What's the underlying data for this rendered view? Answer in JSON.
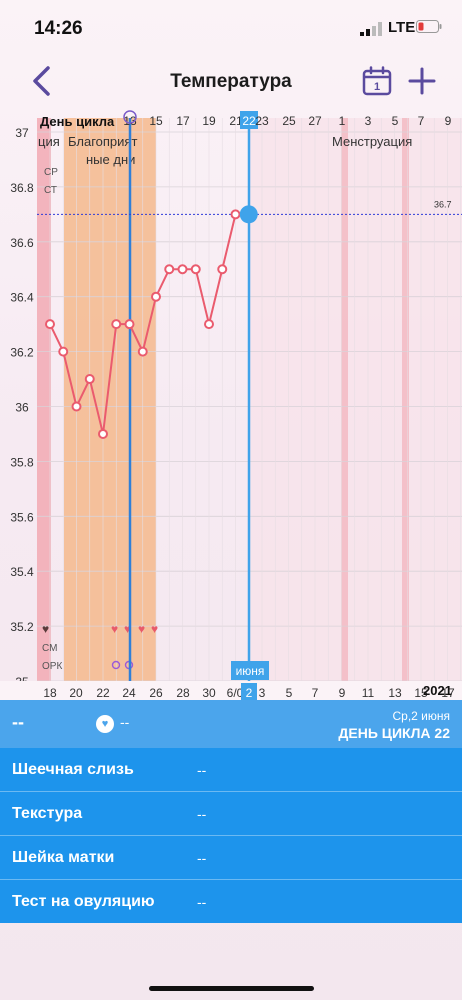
{
  "status": {
    "time": "14:26",
    "network": "LTE"
  },
  "header": {
    "title": "Температура",
    "calendar_day": "1"
  },
  "chart_data": {
    "type": "line",
    "top_axis_label": "День цикла",
    "cycle_days": [
      "13",
      "15",
      "17",
      "19",
      "21",
      "22",
      "23",
      "25",
      "27",
      "1",
      "3",
      "5",
      "7",
      "9"
    ],
    "selected_cycle_day": "22",
    "dates": [
      "18",
      "20",
      "22",
      "24",
      "26",
      "28",
      "30",
      "6/0",
      "2",
      "3",
      "5",
      "7",
      "9",
      "11",
      "13",
      "15",
      "17"
    ],
    "month_label": "июня",
    "year_label": "2021",
    "ylim": [
      35,
      37
    ],
    "y_ticks": [
      "37",
      "36.8",
      "36.6",
      "36.4",
      "36.2",
      "36",
      "35.8",
      "35.6",
      "35.4",
      "35.2",
      "35"
    ],
    "row_labels": [
      "СР",
      "СТ"
    ],
    "bottom_labels": [
      "СМ",
      "ОРК"
    ],
    "reference_line": {
      "value": 36.7,
      "label": "36.7"
    },
    "annotations": [
      "ция",
      "Благоприятные дни",
      "Менструация"
    ],
    "series": [
      {
        "points": [
          {
            "x": "18",
            "y": 36.3
          },
          {
            "x": "19",
            "y": 36.2
          },
          {
            "x": "20",
            "y": 36.0
          },
          {
            "x": "21",
            "y": 36.1
          },
          {
            "x": "22",
            "y": 35.9
          },
          {
            "x": "23",
            "y": 36.3
          },
          {
            "x": "24",
            "y": 36.3
          },
          {
            "x": "25",
            "y": 36.2
          },
          {
            "x": "26",
            "y": 36.4
          },
          {
            "x": "27",
            "y": 36.5
          },
          {
            "x": "28",
            "y": 36.5
          },
          {
            "x": "29",
            "y": 36.5
          },
          {
            "x": "30",
            "y": 36.3
          },
          {
            "x": "31",
            "y": 36.5
          },
          {
            "x": "1",
            "y": 36.7
          },
          {
            "x": "2",
            "y": 36.7
          }
        ],
        "color": "#ea5b6e"
      }
    ],
    "colors": {
      "fertile": "#f5b98c",
      "period": "#f2a9b3",
      "ovulation": "#2f7fd8",
      "today": "#3fa3ea"
    }
  },
  "summary": {
    "temperature": "--",
    "heart_value": "--",
    "date": "Ср,2 июня",
    "cycle_day": "ДЕНЬ ЦИКЛА 22"
  },
  "fields": [
    {
      "label": "Шеечная слизь",
      "value": "--"
    },
    {
      "label": "Текстура",
      "value": "--"
    },
    {
      "label": "Шейка матки",
      "value": "--"
    },
    {
      "label": "Тест на овуляцию",
      "value": "--"
    }
  ]
}
